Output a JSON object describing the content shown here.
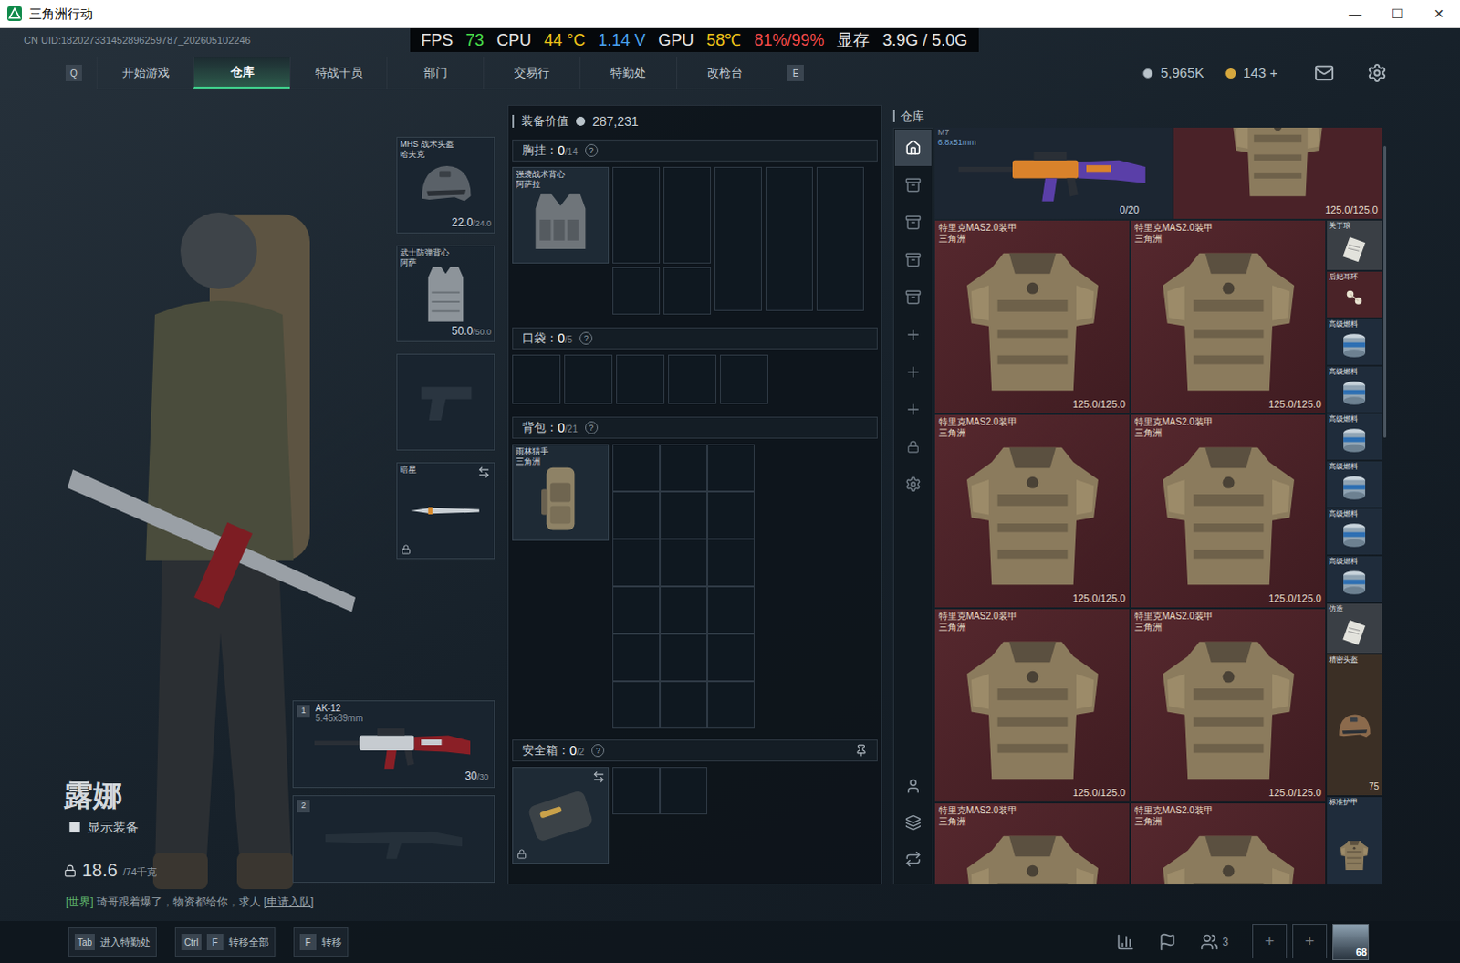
{
  "window": {
    "title": "三角洲行动",
    "controls": [
      "—",
      "☐",
      "✕"
    ]
  },
  "uid": "CN UID:182027331452896259787_202605102246",
  "perf": [
    {
      "text": "FPS",
      "color": "#e6e6e6"
    },
    {
      "text": "73",
      "color": "#4ade4a"
    },
    {
      "text": "CPU",
      "color": "#e6e6e6"
    },
    {
      "text": "44 °C",
      "color": "#f0c419"
    },
    {
      "text": "1.14 V",
      "color": "#4aa3f0"
    },
    {
      "text": "GPU",
      "color": "#e6e6e6"
    },
    {
      "text": "58℃",
      "color": "#f0c419"
    },
    {
      "text": "81%/99%",
      "color": "#f04a4a"
    },
    {
      "text": "显存",
      "color": "#e6e6e6"
    },
    {
      "text": "3.9G / 5.0G",
      "color": "#e6e6e6"
    }
  ],
  "nav": {
    "left_key": "Q",
    "right_key": "E",
    "tabs": [
      {
        "label": "开始游戏",
        "selected": false
      },
      {
        "label": "仓库",
        "selected": true
      },
      {
        "label": "特战干员",
        "selected": false
      },
      {
        "label": "部门",
        "selected": false
      },
      {
        "label": "交易行",
        "selected": false
      },
      {
        "label": "特勤处",
        "selected": false
      },
      {
        "label": "改枪台",
        "selected": false
      }
    ]
  },
  "wallet": {
    "coins": "5,965K",
    "tickets": "143 +"
  },
  "operator": {
    "name": "露娜",
    "show_equipment": {
      "label": "显示装备",
      "checked": false
    },
    "weight": "18.6",
    "weight_max": "/74千克",
    "chat": {
      "channel": "[世界]",
      "message": "琦哥跟着爆了，物资都给你，求人",
      "action": "[申请入队]"
    }
  },
  "gear": [
    {
      "kind": "helmet",
      "name": "MHS 战术头盔",
      "sub": "哈夫克",
      "durability": "22.0",
      "max": "/24.0",
      "locked": false
    },
    {
      "kind": "armor",
      "name": "武士防弹背心",
      "sub": "阿萨",
      "durability": "50.0",
      "max": "/50.0",
      "locked": false
    },
    {
      "kind": "pistol",
      "name": "",
      "sub": "",
      "durability": "",
      "max": "",
      "locked": false
    },
    {
      "kind": "melee",
      "name": "暗星",
      "sub": "",
      "durability": "",
      "max": "",
      "locked": true
    }
  ],
  "weapons": [
    {
      "slot": "1",
      "name": "AK-12",
      "caliber": "5.45x39mm",
      "ammo": "30",
      "max": "/30",
      "empty": false
    },
    {
      "slot": "2",
      "name": "",
      "caliber": "",
      "ammo": "",
      "max": "",
      "empty": true
    }
  ],
  "loadout": {
    "value_label": "装备价值",
    "value": "287,231",
    "chest": {
      "label": "胸挂：",
      "count": "0",
      "max": "/14",
      "help": "?",
      "item": {
        "name": "强袭战术背心",
        "sub": "阿萨拉"
      }
    },
    "pockets": {
      "label": "口袋：",
      "count": "0",
      "max": "/5",
      "help": "?"
    },
    "backpack": {
      "label": "背包：",
      "count": "0",
      "max": "/21",
      "help": "?",
      "item": {
        "name": "雨林猎手",
        "sub": "三角洲"
      }
    },
    "safe": {
      "label": "安全箱：",
      "count": "0",
      "max": "/2",
      "help": "?",
      "locked": true
    }
  },
  "warehouse": {
    "title": "仓库",
    "pages": [
      {
        "kind": "home",
        "selected": true
      },
      {
        "kind": "storage",
        "selected": false
      },
      {
        "kind": "storage",
        "selected": false
      },
      {
        "kind": "storage",
        "selected": false
      },
      {
        "kind": "storage",
        "selected": false
      },
      {
        "kind": "add",
        "selected": false
      },
      {
        "kind": "add",
        "selected": false
      },
      {
        "kind": "add",
        "selected": false
      },
      {
        "kind": "lock",
        "selected": false
      },
      {
        "kind": "settings",
        "selected": false
      }
    ],
    "gun": {
      "name": "M7",
      "caliber": "6.8x51mm",
      "ammo": "0/20"
    },
    "top_armor": {
      "durability": "125.0/125.0"
    },
    "armors": [
      {
        "name": "特里克MAS2.0装甲",
        "sub": "三角洲",
        "durability": "125.0/125.0"
      },
      {
        "name": "特里克MAS2.0装甲",
        "sub": "三角洲",
        "durability": "125.0/125.0"
      },
      {
        "name": "特里克MAS2.0装甲",
        "sub": "三角洲",
        "durability": "125.0/125.0"
      },
      {
        "name": "特里克MAS2.0装甲",
        "sub": "三角洲",
        "durability": "125.0/125.0"
      },
      {
        "name": "特里克MAS2.0装甲",
        "sub": "三角洲",
        "durability": "125.0/125.0"
      },
      {
        "name": "特里克MAS2.0装甲",
        "sub": "三角洲",
        "durability": "125.0/125.0"
      },
      {
        "name": "特里克MAS2.0装甲",
        "sub": "三角洲",
        "durability": ""
      },
      {
        "name": "特里克MAS2.0装甲",
        "sub": "三角洲",
        "durability": ""
      }
    ],
    "small_items": [
      {
        "name": "关于琅",
        "kind": "doc",
        "color": "#3a3f45",
        "durability": ""
      },
      {
        "name": "后妃耳环",
        "kind": "jewel",
        "color": "#4a2328",
        "durability": ""
      },
      {
        "name": "高级燃料",
        "kind": "fuel",
        "color": "#1f2c3b",
        "durability": ""
      },
      {
        "name": "高级燃料",
        "kind": "fuel",
        "color": "#1f2c3b",
        "durability": ""
      },
      {
        "name": "高级燃料",
        "kind": "fuel",
        "color": "#1f2c3b",
        "durability": ""
      },
      {
        "name": "高级燃料",
        "kind": "fuel",
        "color": "#1f2c3b",
        "durability": ""
      },
      {
        "name": "高级燃料",
        "kind": "fuel",
        "color": "#1f2c3b",
        "durability": ""
      },
      {
        "name": "高级燃料",
        "kind": "fuel",
        "color": "#1f2c3b",
        "durability": ""
      },
      {
        "name": "仿造",
        "kind": "doc",
        "color": "#3a3f45",
        "durability": ""
      },
      {
        "name": "精密头盔",
        "kind": "helmet",
        "color": "#3b2f25",
        "durability": "75"
      },
      {
        "name": "标准护甲",
        "kind": "armor",
        "color": "#1f2c3b",
        "durability": ""
      }
    ]
  },
  "hints": [
    {
      "keys": [
        "Tab"
      ],
      "label": "进入特勤处"
    },
    {
      "keys": [
        "Ctrl",
        "F"
      ],
      "label": "转移全部"
    },
    {
      "keys": [
        "F"
      ],
      "label": "转移"
    }
  ],
  "social": {
    "friends": "3",
    "add_slots": [
      "+",
      "+"
    ],
    "level": "68"
  }
}
